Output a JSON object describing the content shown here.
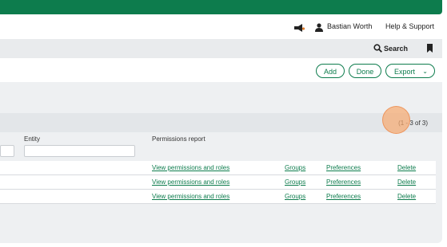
{
  "header": {
    "user_name": "Bastian Worth",
    "help_label": "Help & Support"
  },
  "subnav": {
    "search_label": "Search"
  },
  "actions": {
    "add_label": "Add",
    "done_label": "Done",
    "export_label": "Export"
  },
  "pager": {
    "text": "(1 - 3 of 3)"
  },
  "table": {
    "columns": {
      "entity": "Entity",
      "permissions_report": "Permissions report"
    },
    "rows": [
      {
        "permissions": "View permissions and roles",
        "groups": "Groups",
        "preferences": "Preferences",
        "delete": "Delete"
      },
      {
        "permissions": "View permissions and roles",
        "groups": "Groups",
        "preferences": "Preferences",
        "delete": "Delete"
      },
      {
        "permissions": "View permissions and roles",
        "groups": "Groups",
        "preferences": "Preferences",
        "delete": "Delete"
      }
    ]
  },
  "colors": {
    "brand": "#0d7c4d",
    "panel": "#eef0f2",
    "click_indicator": "#f7a86e"
  },
  "icons": [
    "megaphone-icon",
    "user-icon",
    "search-icon",
    "bookmark-icon",
    "chevron-down-icon"
  ]
}
